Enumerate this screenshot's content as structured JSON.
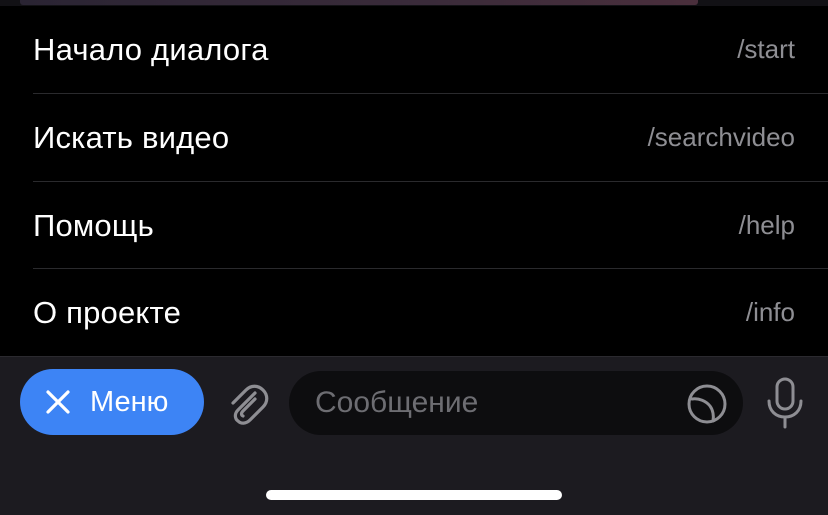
{
  "commands": [
    {
      "title": "Начало диалога",
      "code": "/start"
    },
    {
      "title": "Искать видео",
      "code": "/searchvideo"
    },
    {
      "title": "Помощь",
      "code": "/help"
    },
    {
      "title": "О проекте",
      "code": "/info"
    }
  ],
  "input_bar": {
    "menu_label": "Меню",
    "message_placeholder": "Сообщение",
    "message_value": ""
  },
  "icons": {
    "menu_close": "close-icon",
    "attach": "paperclip-icon",
    "sticker": "sticker-icon",
    "voice": "microphone-icon"
  },
  "colors": {
    "accent": "#3d84f5",
    "panel_bg": "#000000",
    "bar_bg": "#1c1b20",
    "secondary_text": "#8e8e93"
  }
}
